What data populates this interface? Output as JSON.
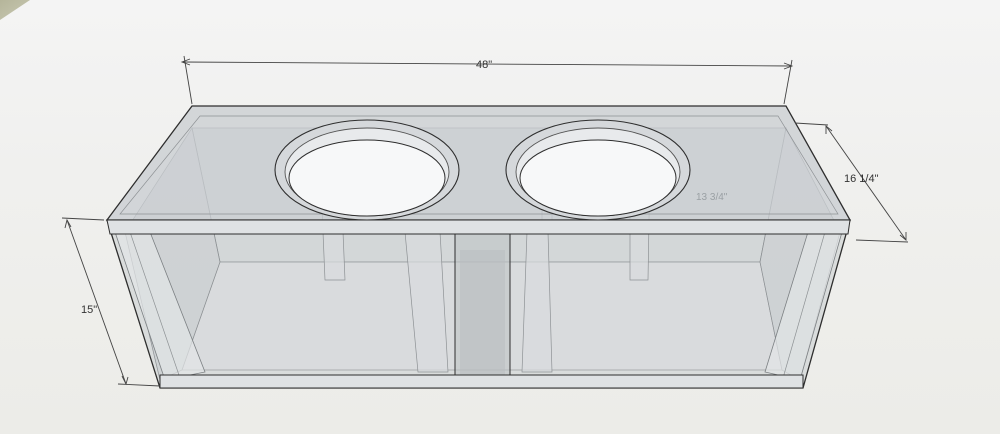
{
  "dimensions": {
    "width": "48\"",
    "depth": "16 1/4\"",
    "height": "15\"",
    "inner_label": "13 3/4\""
  },
  "colors": {
    "background": "#eeeeec",
    "ground": "#b9b9a0",
    "glass": "#c6cacd",
    "edge": "#3a3a3a",
    "dimension_line": "#444444"
  }
}
